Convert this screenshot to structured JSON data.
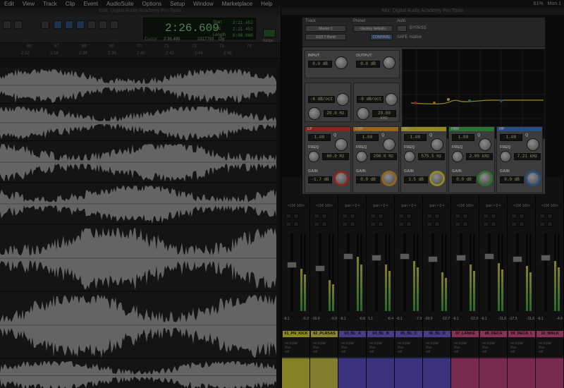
{
  "menu": {
    "items": [
      "Edit",
      "View",
      "Track",
      "Clip",
      "Event",
      "AudioSuite",
      "Options",
      "Setup",
      "Window",
      "Marketplace",
      "Help"
    ],
    "status_battery": "61%",
    "status_user": "Mon 1"
  },
  "edit_window": {
    "title": "Edit: Digital Audio Academy Pro Tools",
    "counter_main": "2:26.609",
    "counter_labels": [
      "Start",
      "End",
      "Length"
    ],
    "counter_values": [
      "2:21.452",
      "2:21.452",
      "0:00.000"
    ],
    "cursor_label": "Cursor",
    "cursor_value": "2:36.486",
    "dly_value": "2317793",
    "dly_label": "Dly",
    "nudge_label": "Nudge",
    "ruler_bars": [
      "66",
      "67",
      "68",
      "69",
      "70",
      "71",
      "72",
      "73",
      "74"
    ],
    "ruler_times": [
      "2:32",
      "2:34",
      "2:36",
      "2:38",
      "2:40",
      "2:42",
      "2:44",
      "2:46"
    ]
  },
  "mix_window": {
    "title": "Mix: Digital Audio Academy Pro Tools",
    "strips": [
      {
        "name": "01_PN_KICK",
        "color": "#d6d635",
        "val_l": "-9.1",
        "val_r": "-5.2",
        "bottom": "#cdc73d"
      },
      {
        "name": "02_PLRSAS",
        "color": "#d6cf45",
        "val_l": "-16.0",
        "val_r": "-9.9",
        "bottom": "#c8c348"
      },
      {
        "name": "03_BL_A",
        "color": "#6e5fd0",
        "val_l": "-5.1",
        "val_r": "-6.6",
        "bottom": "#5b4fc4"
      },
      {
        "name": "04_BL_B",
        "color": "#6e5fd0",
        "val_l": "1.1",
        "val_r": "-6.4",
        "bottom": "#5b4fc4"
      },
      {
        "name": "05_BL_C",
        "color": "#6e5fd0",
        "val_l": "-0.1",
        "val_r": "-7.3",
        "bottom": "#5b4fc4"
      },
      {
        "name": "06_BL_D",
        "color": "#6e5fd0",
        "val_l": "-20.0",
        "val_r": "-12.7",
        "bottom": "#5b4fc4"
      },
      {
        "name": "07_LANKE",
        "color": "#d04c83",
        "val_l": "-6.1",
        "val_r": "-12.3",
        "bottom": "#b94276"
      },
      {
        "name": "08_DECA",
        "color": "#d04c83",
        "val_l": "-6.1",
        "val_r": "-11.6",
        "bottom": "#b94276"
      },
      {
        "name": "09_DECA_L",
        "color": "#d04c83",
        "val_l": "-17.3",
        "val_r": "-11.6",
        "bottom": "#b94276"
      },
      {
        "name": "10_WALK",
        "color": "#d04c83",
        "val_l": "-6.1",
        "val_r": "-4.6",
        "bottom": "#b94276"
      }
    ],
    "pan_labels": [
      "<100 100>",
      "<100 100>",
      "pan > 0 <",
      "pan > 0 <",
      "pan > 0 <",
      "pan > 0 <",
      "<100 100>",
      "pan > 0 <",
      "<100 100>",
      "<100 100>"
    ],
    "io_label": "no input",
    "io_out": "Bus",
    "vol_label": "vol",
    "fader_levels": [
      0.6,
      0.55,
      0.72,
      0.7,
      0.72,
      0.68,
      0.7,
      0.72,
      0.68,
      0.7
    ],
    "meter_levels": [
      0.55,
      0.4,
      0.7,
      0.6,
      0.65,
      0.5,
      0.6,
      0.62,
      0.58,
      0.65
    ]
  },
  "plugin": {
    "track_label": "Track",
    "preset_label": "Preset",
    "auto_label": "Auto",
    "track_name": "Master 1",
    "preset_name": "<factory default>",
    "insert_name": "EQ3 7-Band",
    "compare_label": "COMPARE",
    "bypass_label": "BYPASS",
    "safe_label": "SAFE",
    "native_label": "Native",
    "input_label": "INPUT",
    "output_label": "OUTPUT",
    "input_value": "0.0 dB",
    "output_value": "0.0 dB",
    "hpf_value": "-6 dB/oct",
    "hpf_freq": "20.0 Hz",
    "lpf_value": "-6 dB/oct",
    "lpf_freq": "20.00 kHz",
    "bands": [
      {
        "label": "LF",
        "color": "#d33a2c",
        "q": "1.00",
        "freq": "60.0 Hz",
        "gain": "-1.7 dB"
      },
      {
        "label": "LMF",
        "color": "#e79a2a",
        "q": "1.00",
        "freq": "200.0 Hz",
        "gain": "0.0 dB"
      },
      {
        "label": "MF",
        "color": "#e6cf39",
        "q": "1.00",
        "freq": "575.5 Hz",
        "gain": "1.5 dB"
      },
      {
        "label": "HMF",
        "color": "#45b049",
        "q": "1.00",
        "freq": "2.00 kHz",
        "gain": "0.0 dB"
      },
      {
        "label": "HF",
        "color": "#3e79c7",
        "q": "1.00",
        "freq": "7.21 kHz",
        "gain": "0.0 dB"
      }
    ],
    "freq_label": "FREQ",
    "gain_label": "GAIN",
    "q_label": "Q"
  }
}
